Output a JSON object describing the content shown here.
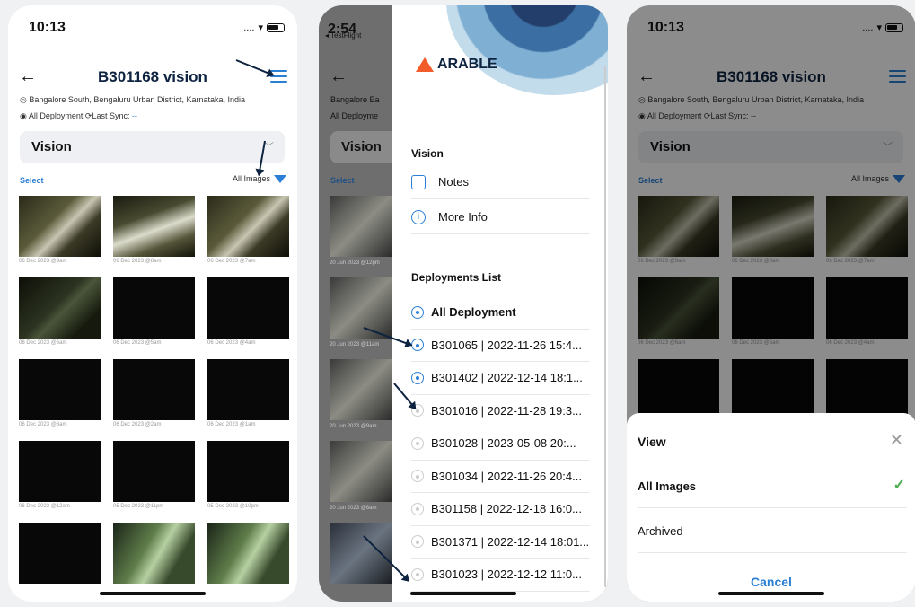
{
  "status": {
    "time_a": "10:13",
    "time_b": "2:54",
    "time_c": "10:13",
    "dots": "....",
    "testflight": "◂ TestFlight"
  },
  "header": {
    "title": "B301168 vision",
    "back": "←"
  },
  "info": {
    "location": "Bangalore South, Bengaluru Urban District, Karnataka, India",
    "location_short": "Bangalore Ea",
    "deployment": "All Deployment",
    "deployment_short": "All Deployme",
    "last_sync_label": "Last Sync:",
    "last_sync_value": "--"
  },
  "dropdown": {
    "label": "Vision",
    "chevron": "﹀"
  },
  "toolbar": {
    "select": "Select",
    "filter_label": "All Images"
  },
  "thumbs": [
    {
      "caption": "06 Dec 2023 @9am",
      "style": "lit"
    },
    {
      "caption": "06 Dec 2023 @8am",
      "style": "lit2"
    },
    {
      "caption": "06 Dec 2023 @7am",
      "style": "lit"
    },
    {
      "caption": "06 Dec 2023 @6am",
      "style": "dim"
    },
    {
      "caption": "06 Dec 2023 @5am",
      "style": "dark"
    },
    {
      "caption": "06 Dec 2023 @4am",
      "style": "dark"
    },
    {
      "caption": "06 Dec 2023 @3am",
      "style": "dark"
    },
    {
      "caption": "06 Dec 2023 @2am",
      "style": "dark"
    },
    {
      "caption": "06 Dec 2023 @1am",
      "style": "dark"
    },
    {
      "caption": "06 Dec 2023 @12am",
      "style": "dark"
    },
    {
      "caption": "05 Dec 2023 @11pm",
      "style": "dark"
    },
    {
      "caption": "05 Dec 2023 @10pm",
      "style": "dark"
    },
    {
      "caption": "",
      "style": "dark"
    },
    {
      "caption": "",
      "style": "green"
    },
    {
      "caption": "",
      "style": "green"
    }
  ],
  "bg_captions": [
    "20 Jun 2023 @12pm",
    "20 Jun 2023 @11am",
    "20 Jun 2023 @9am",
    "20 Jun 2023 @8am"
  ],
  "drawer": {
    "brand": "ARABLE",
    "vision_section": "Vision",
    "notes": "Notes",
    "more_info": "More Info",
    "deployments_section": "Deployments List",
    "deployments": [
      {
        "label": "All Deployment",
        "bold": true,
        "active": true
      },
      {
        "label": "B301065 | 2022-11-26 15:4...",
        "bold": false,
        "active": true
      },
      {
        "label": "B301402 | 2022-12-14 18:1...",
        "bold": false,
        "active": true
      },
      {
        "label": "B301016 | 2022-11-28 19:3...",
        "bold": false,
        "active": false
      },
      {
        "label": "B301028 | 2023-05-08 20:...",
        "bold": false,
        "active": false
      },
      {
        "label": "B301034 | 2022-11-26 20:4...",
        "bold": false,
        "active": false
      },
      {
        "label": "B301158 | 2022-12-18 16:0...",
        "bold": false,
        "active": false
      },
      {
        "label": "B301371 | 2022-12-14 18:01...",
        "bold": false,
        "active": false
      },
      {
        "label": "B301023 | 2022-12-12 11:0...",
        "bold": false,
        "active": false
      }
    ]
  },
  "sheet": {
    "title": "View",
    "close": "✕",
    "option_all": "All Images",
    "option_archived": "Archived",
    "check": "✓",
    "cancel": "Cancel"
  },
  "colors": {
    "accent": "#2b7fd4",
    "navy": "#0d2340",
    "brand_orange": "#f25c2a",
    "check_green": "#4caf50"
  }
}
